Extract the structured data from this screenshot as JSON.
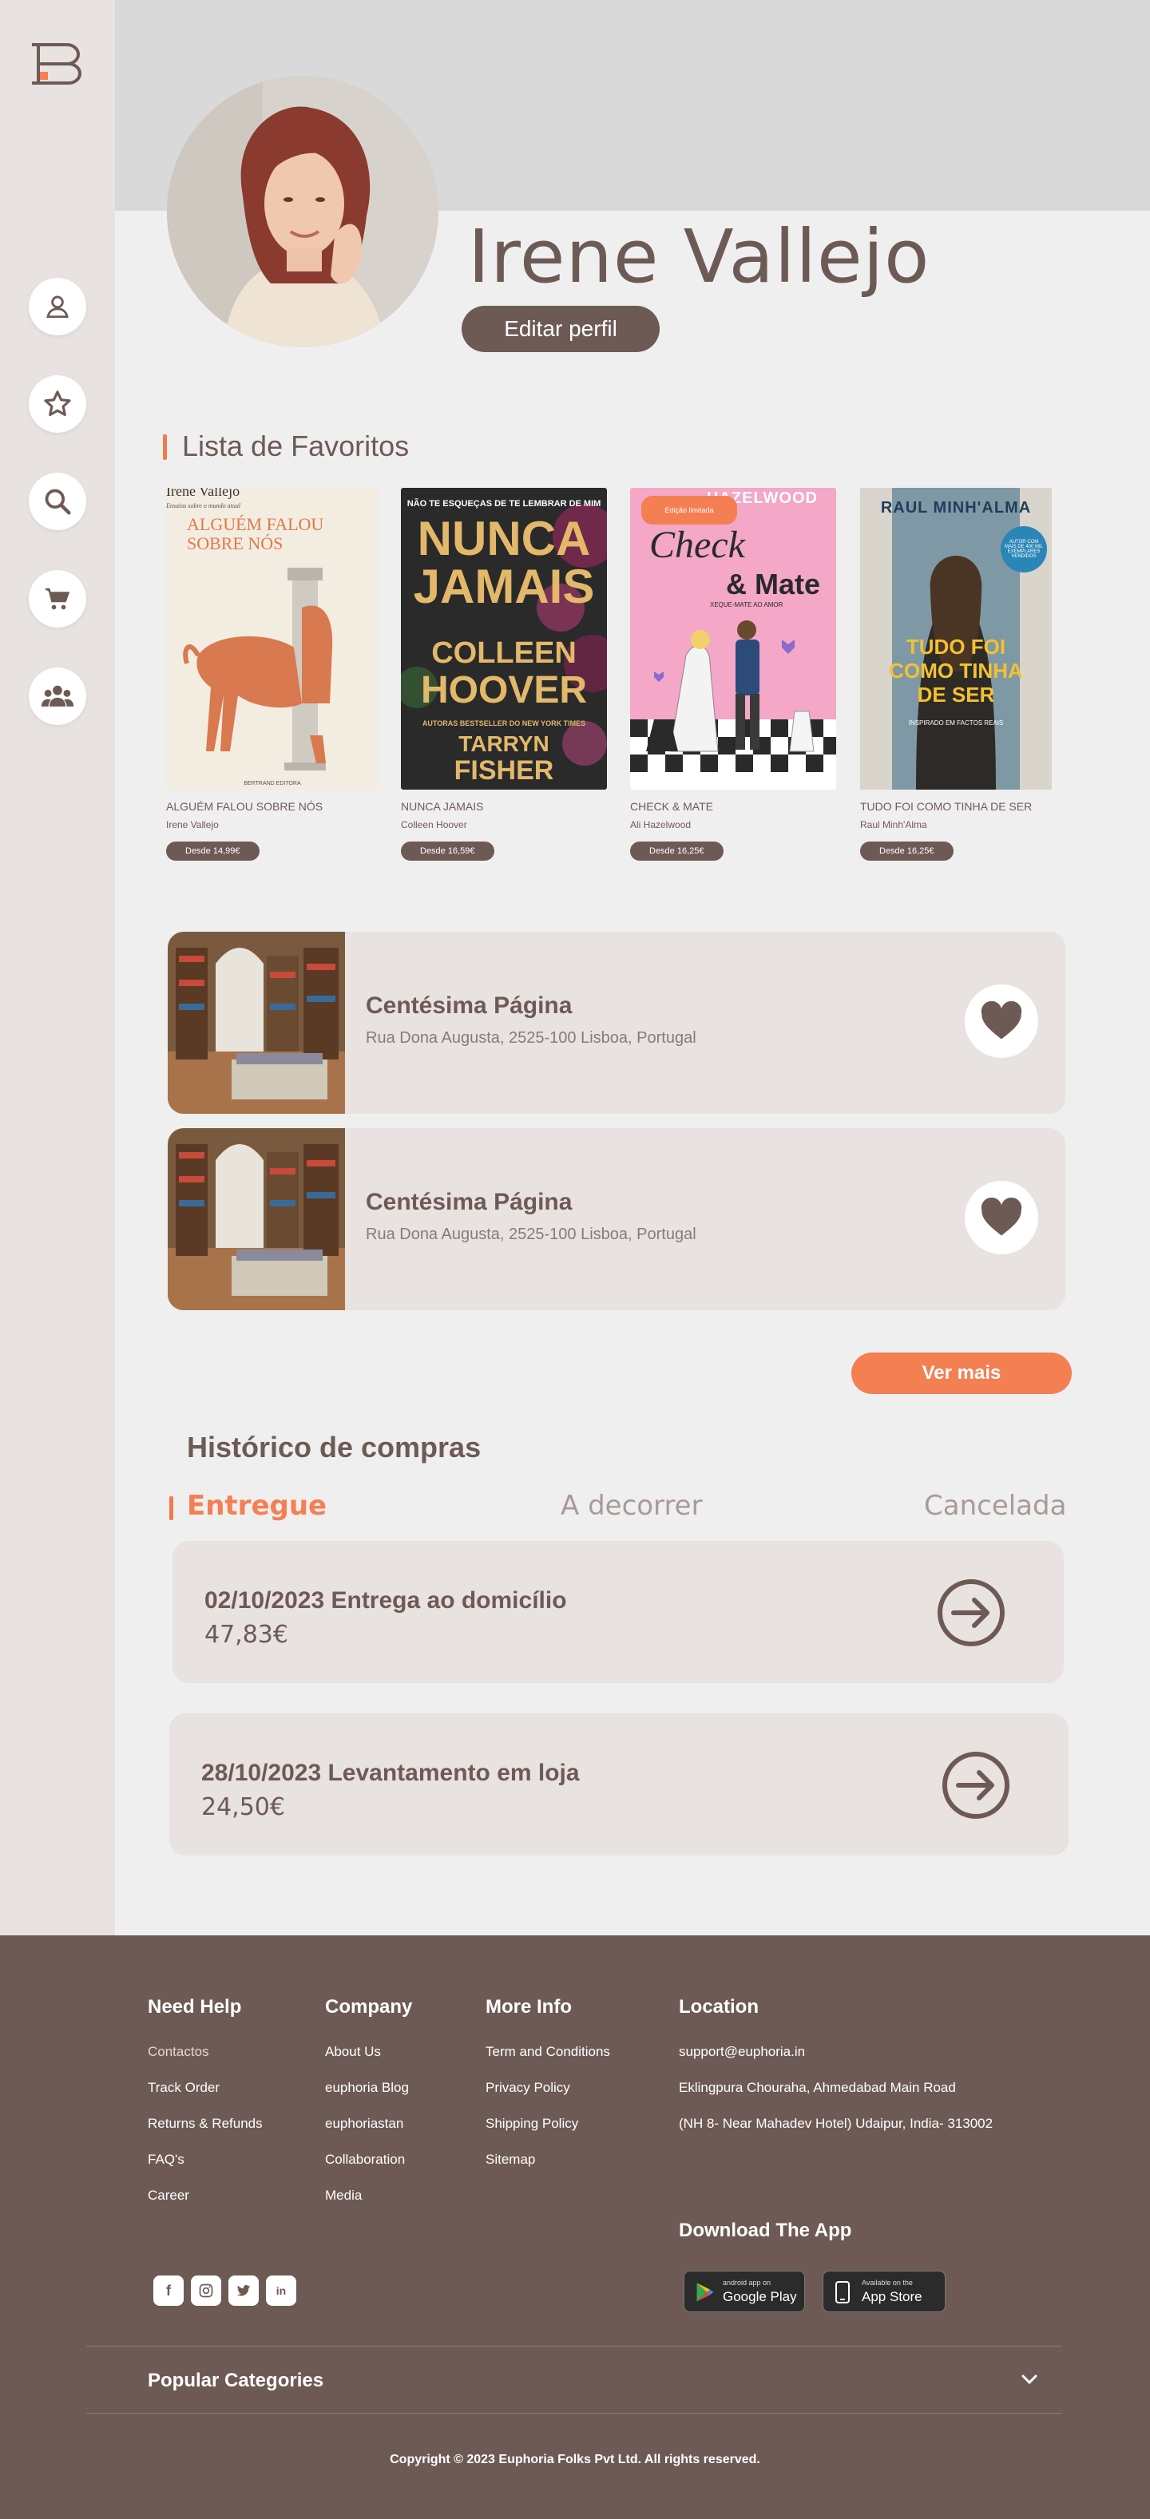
{
  "sidebar": {
    "items": [
      {
        "icon": "user-icon"
      },
      {
        "icon": "star-icon"
      },
      {
        "icon": "search-icon"
      },
      {
        "icon": "cart-icon"
      },
      {
        "icon": "group-icon"
      }
    ]
  },
  "profile": {
    "name": "Irene Vallejo",
    "edit_label": "Editar perfil"
  },
  "favorites": {
    "title": "Lista de Favoritos",
    "books": [
      {
        "title": "ALGUÉM FALOU SOBRE NÓS",
        "author": "Irene Vallejo",
        "price": "Desde 14,99€",
        "cover": {
          "top": "Irene Vallejo",
          "sub": "Ensaios sobre o mundo atual",
          "main": "ALGUÉM FALOU SOBRE NÓS",
          "bottom": "BERTRAND EDITORA"
        }
      },
      {
        "title": "NUNCA JAMAIS",
        "author": "Colleen Hoover",
        "price": "Desde 16,59€",
        "cover": {
          "top": "NÃO TE ESQUEÇAS DE TE LEMBRAR DE MIM",
          "main1": "NUNCA",
          "main2": "JAMAIS",
          "author1": "COLLEEN",
          "author2": "HOOVER",
          "sub": "AUTORAS BESTSELLER DO NEW YORK TIMES",
          "author3": "TARRYN",
          "author4": "FISHER"
        }
      },
      {
        "title": "CHECK & MATE",
        "author": "Ali Hazelwood",
        "price": "Desde 16,25€",
        "cover": {
          "top": "HAZELWOOD",
          "badge": "Edição limitada",
          "main1": "Check",
          "main2": "& Mate",
          "sub": "XEQUE-MATE AO AMOR"
        }
      },
      {
        "title": "TUDO FOI COMO TINHA DE SER",
        "author": "Raul Minh'Alma",
        "price": "Desde 16,25€",
        "cover": {
          "top": "RAUL MINH'ALMA",
          "badge": "AUTOR COM MAIS DE 400 MIL EXEMPLARES VENDIDOS",
          "main1": "TUDO FOI",
          "main2": "COMO TINHA",
          "main3": "DE SER",
          "sub": "INSPIRADO EM FACTOS REAIS"
        }
      }
    ]
  },
  "stores": [
    {
      "name": "Centésima Página",
      "address": "Rua Dona Augusta, 2525-100 Lisboa, Portugal"
    },
    {
      "name": "Centésima Página",
      "address": "Rua Dona Augusta, 2525-100 Lisboa, Portugal"
    }
  ],
  "more_label": "Ver mais",
  "history": {
    "title": "Histórico de compras",
    "tabs": [
      "Entregue",
      "A decorrer",
      "Cancelada"
    ],
    "active_tab": "Entregue",
    "orders": [
      {
        "title": "02/10/2023 Entrega ao domicílio",
        "price": "47,83€"
      },
      {
        "title": "28/10/2023 Levantamento em loja",
        "price": "24,50€"
      }
    ]
  },
  "footer": {
    "need_help": {
      "title": "Need Help",
      "links": [
        "Contactos",
        "Track Order",
        "Returns & Refunds",
        "FAQ's",
        "Career"
      ]
    },
    "company": {
      "title": "Company",
      "links": [
        "About Us",
        "euphoria Blog",
        "euphoriastan",
        "Collaboration",
        "Media"
      ]
    },
    "more_info": {
      "title": "More Info",
      "links": [
        "Term and Conditions",
        "Privacy Policy",
        "Shipping Policy",
        "Sitemap"
      ]
    },
    "location": {
      "title": "Location",
      "lines": [
        "support@euphoria.in",
        "Eklingpura Chouraha, Ahmedabad Main Road",
        "(NH 8- Near Mahadev Hotel) Udaipur, India- 313002"
      ]
    },
    "download_title": "Download The App",
    "google_play": {
      "small": "android app on",
      "big": "Google Play"
    },
    "app_store": {
      "small": "Available on the",
      "big": "App Store"
    },
    "social": [
      "facebook-icon",
      "instagram-icon",
      "twitter-icon",
      "linkedin-icon"
    ],
    "social_text": {
      "facebook": "f",
      "linkedin": "in"
    },
    "popular": "Popular Categories",
    "copyright": "Copyright © 2023 Euphoria Folks Pvt Ltd. All rights reserved."
  },
  "colors": {
    "brown": "#6e5a55",
    "accent": "#f47f52",
    "card": "#e8e2e0",
    "page": "#f0efef"
  }
}
